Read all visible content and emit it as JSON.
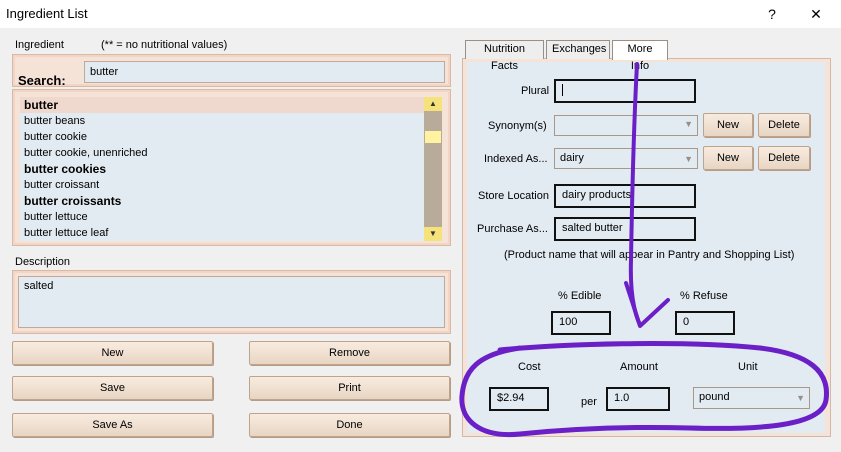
{
  "window": {
    "title": "Ingredient List",
    "help_glyph": "?",
    "close_glyph": "✕"
  },
  "left": {
    "ingredient_label": "Ingredient",
    "note": "(** =  no nutritional values)",
    "search_label": "Search:",
    "search_value": "butter",
    "list": [
      {
        "label": "butter",
        "style": "sel"
      },
      {
        "label": "butter beans",
        "style": ""
      },
      {
        "label": "butter cookie",
        "style": ""
      },
      {
        "label": "butter cookie, unenriched",
        "style": ""
      },
      {
        "label": "butter cookies",
        "style": "strong"
      },
      {
        "label": "butter croissant",
        "style": ""
      },
      {
        "label": "butter croissants",
        "style": "strong"
      },
      {
        "label": "butter lettuce",
        "style": ""
      },
      {
        "label": "butter lettuce leaf",
        "style": ""
      }
    ],
    "description_label": "Description",
    "description_value": "salted",
    "buttons": {
      "new": "New",
      "remove": "Remove",
      "save": "Save",
      "print": "Print",
      "save_as": "Save As",
      "done": "Done"
    }
  },
  "tabs": [
    {
      "label": "Nutrition Facts",
      "active": false
    },
    {
      "label": "Exchanges",
      "active": false
    },
    {
      "label": "More Info",
      "active": true
    }
  ],
  "more_info": {
    "plural_label": "Plural",
    "plural_value": "",
    "synonyms_label": "Synonym(s)",
    "synonyms_value": "",
    "indexed_label": "Indexed As...",
    "indexed_value": "dairy",
    "new_label": "New",
    "delete_label": "Delete",
    "store_label": "Store Location",
    "store_value": "dairy products",
    "purchase_label": "Purchase As...",
    "purchase_value": "salted butter",
    "purchase_note": "(Product name that will appear in Pantry and Shopping List)",
    "edible_label": "% Edible",
    "edible_value": "100",
    "refuse_label": "% Refuse",
    "refuse_value": "0",
    "cost_label": "Cost",
    "amount_label": "Amount",
    "unit_label": "Unit",
    "cost_value": "$2.94",
    "per_label": "per",
    "amount_value": "1.0",
    "unit_value": "pound"
  },
  "colors": {
    "annotation": "#6a1fc7",
    "frame": "#f6e3d8",
    "field": "#e3ebf2"
  }
}
